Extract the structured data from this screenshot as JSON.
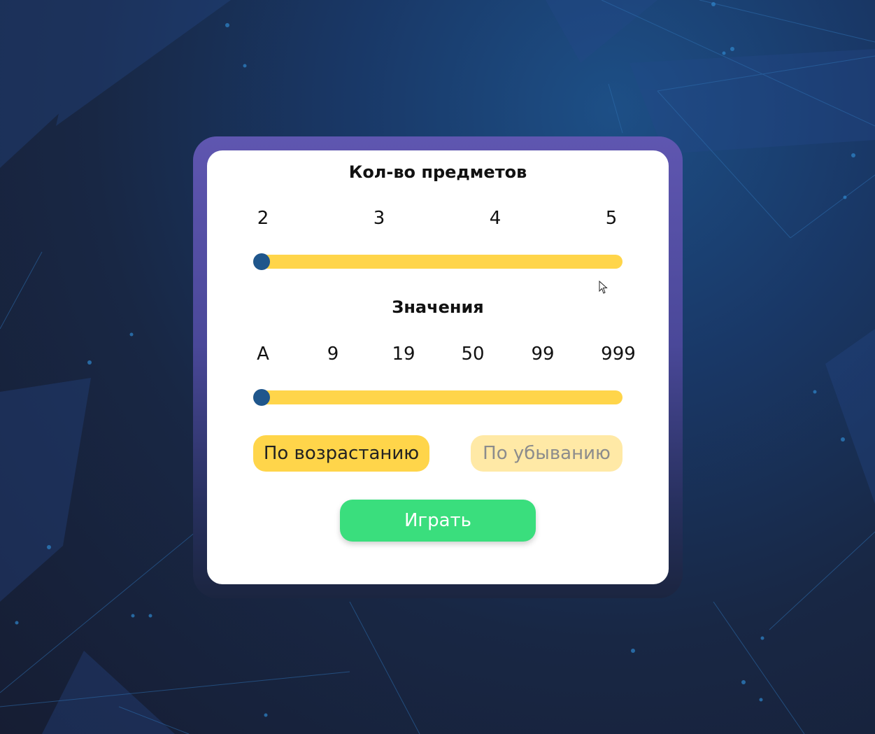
{
  "count_section": {
    "title": "Кол-во предметов",
    "ticks": [
      "2",
      "3",
      "4",
      "5"
    ],
    "selected": "2"
  },
  "values_section": {
    "title": "Значения",
    "ticks": [
      "A",
      "9",
      "19",
      "50",
      "99",
      "999"
    ],
    "selected": "A"
  },
  "order": {
    "ascending_label": "По возрастанию",
    "descending_label": "По убыванию",
    "selected": "ascending"
  },
  "play_label": "Играть",
  "colors": {
    "track": "#ffd54a",
    "thumb": "#1f568c",
    "play_button": "#3ade7d",
    "active_order": "#ffd54a",
    "inactive_order": "#ffe9a6"
  }
}
